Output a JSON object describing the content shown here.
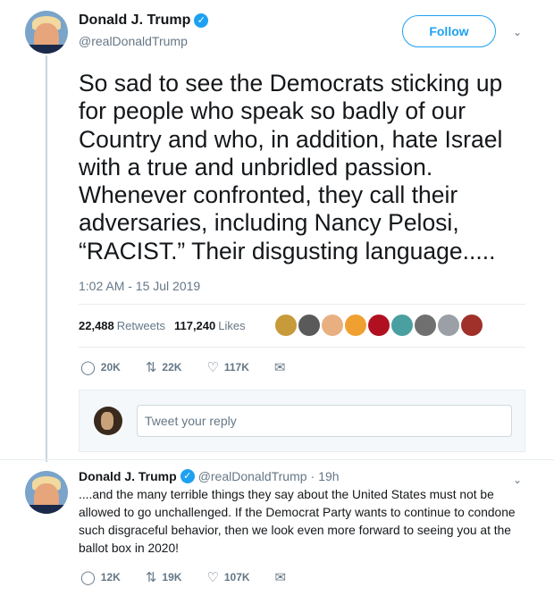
{
  "main_tweet": {
    "name": "Donald J. Trump",
    "handle": "@realDonaldTrump",
    "follow_label": "Follow",
    "text": "So sad to see the Democrats sticking up for people who speak so badly of our Country and who, in addition, hate Israel with a true and unbridled passion. Whenever confronted, they call their adversaries, including Nancy Pelosi, “RACIST.” Their disgusting language.....",
    "timestamp": "1:02 AM - 15 Jul 2019",
    "retweets_count": "22,488",
    "retweets_label": "Retweets",
    "likes_count": "117,240",
    "likes_label": "Likes",
    "actions": {
      "replies": "20K",
      "retweets": "22K",
      "likes": "117K"
    },
    "liker_colors": [
      "#c79a3a",
      "#5a5a5a",
      "#e8b080",
      "#f0a030",
      "#b01020",
      "#4aa0a0",
      "#707070",
      "#9aa0a6",
      "#a0302a"
    ]
  },
  "reply_box": {
    "placeholder": "Tweet your reply"
  },
  "reply_tweet": {
    "name": "Donald J. Trump",
    "handle": "@realDonaldTrump",
    "time": "19h",
    "text": "....and the many terrible things they say about the United States must not be allowed to go unchallenged. If the Democrat Party wants to continue to condone such disgraceful behavior, then we look even more forward to seeing you at the ballot box in 2020!",
    "actions": {
      "replies": "12K",
      "retweets": "19K",
      "likes": "107K"
    }
  },
  "colors": {
    "accent": "#1da1f2",
    "secondary_text": "#657786",
    "divider": "#e6ecf0"
  },
  "icons": {
    "verified": "verified-badge-icon",
    "chevron": "chevron-down-icon",
    "reply": "reply-icon",
    "retweet": "retweet-icon",
    "like": "heart-icon",
    "message": "envelope-icon"
  }
}
